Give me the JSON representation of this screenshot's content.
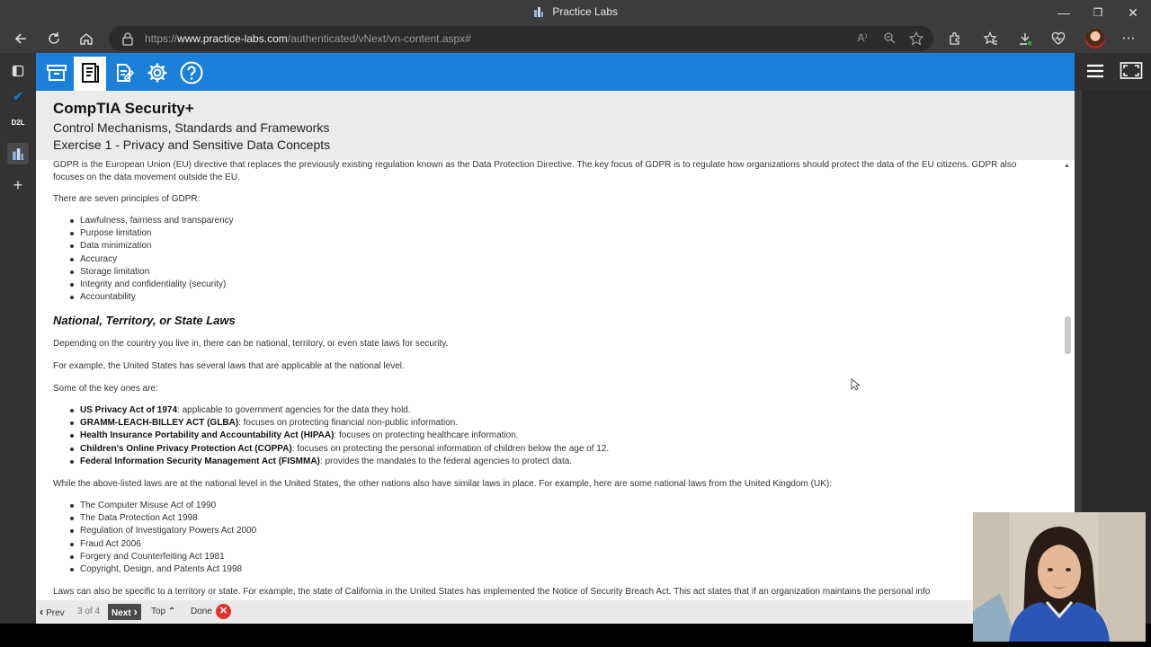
{
  "window": {
    "title": "Practice Labs",
    "min_glyph": "—",
    "max_glyph": "❐",
    "close_glyph": "✕"
  },
  "browser": {
    "url_prefix": "https://",
    "url_domain": "www.practice-labs.com",
    "url_path": "/authenticated/vNext/vn-content.aspx#",
    "icons": [
      "back-icon",
      "refresh-icon",
      "home-icon",
      "lock-icon",
      "read-aloud-icon",
      "zoom-icon",
      "add-favorite-icon",
      "extensions-icon",
      "favorites-icon",
      "downloads-icon",
      "browser-essentials-icon",
      "profile-avatar",
      "more-icon"
    ]
  },
  "tabstrip": {
    "icons": [
      "tab-actions-icon",
      "checkmark-tab-icon",
      "d2l-tab-icon",
      "practice-labs-tab-icon",
      "new-tab-icon"
    ],
    "d2l_label": "D2L"
  },
  "toolbar": {
    "icons": [
      "archive-icon",
      "lab-manual-icon",
      "notes-icon",
      "settings-icon",
      "help-icon"
    ]
  },
  "header": {
    "course": "CompTIA Security+",
    "module": "Control Mechanisms, Standards and Frameworks",
    "exercise": "Exercise 1 - Privacy and Sensitive Data Concepts"
  },
  "content": {
    "gdpr_intro": "GDPR is the European Union (EU) directive that replaces the previously existing regulation known as the Data Protection Directive. The key focus of GDPR is to regulate how organizations should protect the data of the EU citizens. GDPR also focuses on the data movement outside the EU.",
    "principles_intro": "There are seven principles of GDPR:",
    "principles": [
      "Lawfulness, fairness and transparency",
      "Purpose limitation",
      "Data minimization",
      "Accuracy",
      "Storage limitation",
      "Integrity and confidentiality (security)",
      "Accountability"
    ],
    "section_heading": "National, Territory, or State Laws",
    "para1": "Depending on the country you live in, there can be national, territory, or even state laws for security.",
    "para2": "For example, the United States has several laws that are applicable at the national level.",
    "para3": "Some of the key ones are:",
    "us_laws": [
      {
        "name": "US Privacy Act of 1974",
        "desc": ": applicable to government agencies for the data they hold."
      },
      {
        "name": "GRAMM-LEACH-BILLEY ACT (GLBA)",
        "desc": ": focuses on protecting financial non-public information."
      },
      {
        "name": "Health Insurance Portability and Accountability Act (HIPAA)",
        "desc": ": focuses on protecting healthcare information."
      },
      {
        "name": "Children's Online Privacy Protection Act (COPPA)",
        "desc": ": focuses on protecting the personal information of children below the age of 12."
      },
      {
        "name": "Federal Information Security Management Act (FISMMA)",
        "desc": ": provides the mandates to the federal agencies to protect data."
      }
    ],
    "para4": "While the above-listed laws are at the national level in the United States, the other nations also have similar laws in place. For example, here are some national laws from the United Kingdom (UK):",
    "uk_laws": [
      "The Computer Misuse Act of 1990",
      "The Data Protection Act 1998",
      "Regulation of Investigatory Powers Act 2000",
      "Fraud Act 2006",
      "Forgery and Counterfeiting Act 1981",
      "Copyright, Design, and Patents Act 1998"
    ],
    "para5": "Laws can also be specific to a territory or state. For example, the state of California in the United States has implemented the Notice of Security Breach Act. This act states that if an organization maintains the personal info"
  },
  "bottomnav": {
    "prev": "Prev",
    "counter": "3 of 4",
    "next": "Next",
    "top": "Top",
    "done": "Done"
  },
  "colors": {
    "toolbar_blue": "#1a80d8",
    "header_gray": "#ebebe9",
    "done_red": "#e03434"
  }
}
